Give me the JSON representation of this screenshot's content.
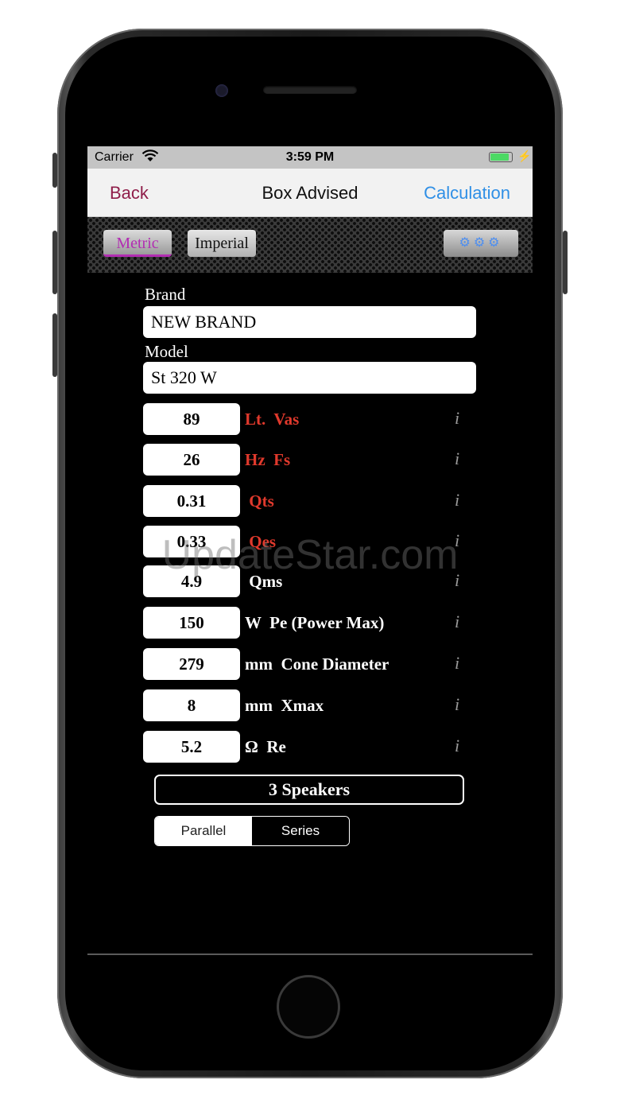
{
  "status_bar": {
    "carrier": "Carrier",
    "time": "3:59 PM",
    "battery_level": 0.9
  },
  "nav": {
    "back": "Back",
    "title": "Box Advised",
    "calculation": "Calculation"
  },
  "toolbar": {
    "metric": "Metric",
    "imperial": "Imperial",
    "gear_icons": "⚙⚙⚙"
  },
  "form": {
    "brand_label": "Brand",
    "brand_value": "NEW BRAND",
    "model_label": "Model",
    "model_value": "St 320 W"
  },
  "params": [
    {
      "value": "89",
      "unit": "Lt.",
      "name": "Vas",
      "label": "Lt.  Vas",
      "color": "#e0392c"
    },
    {
      "value": "26",
      "unit": "Hz",
      "name": "Fs",
      "label": "Hz  Fs",
      "color": "#e0392c"
    },
    {
      "value": "0.31",
      "name": "Qts",
      "label": " Qts",
      "color": "#e0392c"
    },
    {
      "value": "0.33",
      "name": "Qes",
      "label": " Qes",
      "color": "#e0392c"
    },
    {
      "value": "4.9",
      "name": "Qms",
      "label": " Qms",
      "color": "#ffffff"
    },
    {
      "value": "150",
      "unit": "W",
      "name": "Pe (Power Max)",
      "label": "W  Pe (Power Max)",
      "color": "#ffffff"
    },
    {
      "value": "279",
      "unit": "mm",
      "name": "Cone Diameter",
      "label": "mm  Cone Diameter",
      "color": "#ffffff"
    },
    {
      "value": "8",
      "unit": "mm",
      "name": "Xmax",
      "label": "mm  Xmax",
      "color": "#ffffff"
    },
    {
      "value": "5.2",
      "unit": "Ω",
      "name": "Re",
      "label": "Ω  Re",
      "color": "#ffffff"
    }
  ],
  "info_glyph": "i",
  "speakers": {
    "label": "3  Speakers"
  },
  "wiring": {
    "options": [
      "Parallel",
      "Series"
    ],
    "selected": "Series"
  },
  "watermark": "UpdateStar.com"
}
